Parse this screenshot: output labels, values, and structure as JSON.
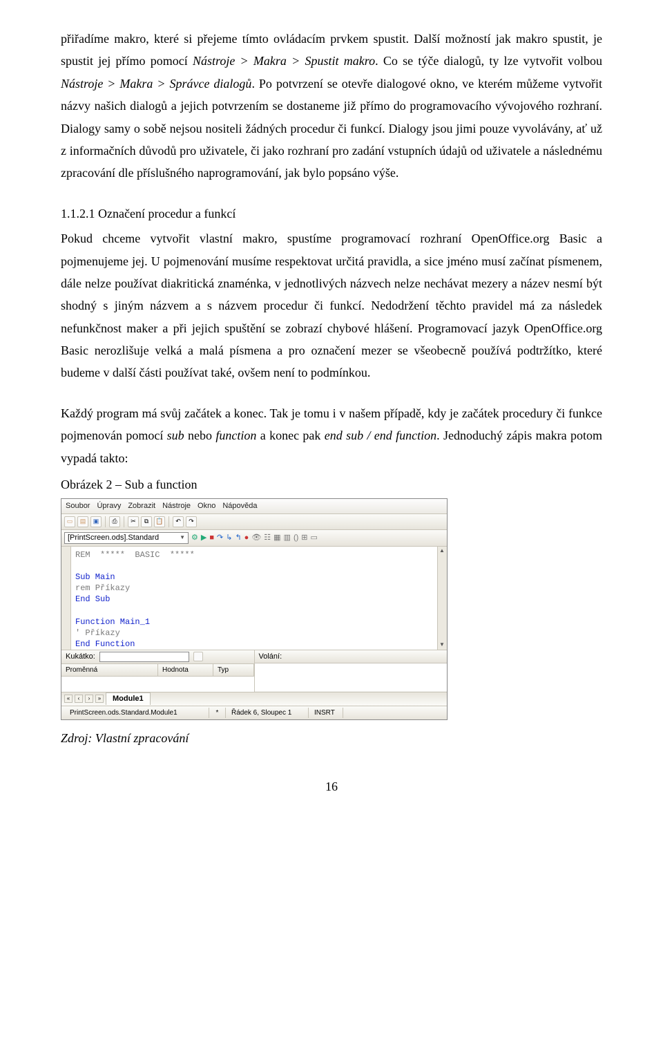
{
  "paragraphs": {
    "p1_a": "přiřadíme makro, které si přejeme tímto ovládacím prvkem spustit. Další možností jak makro spustit, je spustit jej přímo pomocí ",
    "p1_i1": "Nástroje > Makra > Spustit makro",
    "p1_b": ". Co se týče dialogů, ty lze vytvořit volbou ",
    "p1_i2": "Nástroje > Makra > Správce dialogů",
    "p1_c": ". Po potvrzení se otevře dialogové okno, ve kterém můžeme vytvořit názvy našich dialogů a jejich potvrzením se dostaneme již přímo do programovacího vývojového rozhraní. Dialogy samy o sobě nejsou nositeli žádných procedur či funkcí. Dialogy jsou jimi pouze vyvolávány, ať už z informačních důvodů pro uživatele, či jako rozhraní pro zadání vstupních údajů od uživatele a následnému zpracování dle příslušného naprogramování, jak bylo popsáno výše.",
    "heading": "1.1.2.1 Označení procedur a funkcí",
    "p2_a": "Pokud chceme vytvořit vlastní makro, spustíme programovací rozhraní OpenOffice.org Basic a pojmenujeme jej. U pojmenování musíme respektovat určitá pravidla, a sice jméno musí začínat písmenem, dále nelze používat diakritická znaménka, v jednotlivých názvech nelze nechávat mezery a název nesmí být shodný s jiným názvem a s názvem procedur či funkcí. Nedodržení těchto pravidel má za následek nefunkčnost maker a při jejich spuštění se zobrazí chybové hlášení. Programovací jazyk OpenOffice.org Basic nerozlišuje velká a malá písmena a pro označení mezer se všeobecně používá podtržítko, které budeme v další části používat také, ovšem není to podmínkou.",
    "p3_a": "Každý program má svůj začátek a konec. Tak je tomu i v našem případě, kdy je začátek procedury či funkce pojmenován pomocí ",
    "p3_i1": "sub",
    "p3_b": " nebo ",
    "p3_i2": "function",
    "p3_c": " a konec pak ",
    "p3_i3": "end sub / end function",
    "p3_d": ". Jednoduchý zápis makra potom vypadá takto:",
    "fig_caption": "Obrázek 2 – Sub a function"
  },
  "ide": {
    "menu": [
      "Soubor",
      "Úpravy",
      "Zobrazit",
      "Nástroje",
      "Okno",
      "Nápověda"
    ],
    "combo_text": "[PrintScreen.ods].Standard",
    "code": {
      "l1": "REM  *****  BASIC  *****",
      "l2": "",
      "l3": "Sub Main",
      "l4": "rem Příkazy",
      "l5": "End Sub",
      "l6": "",
      "l7": "Function Main_1",
      "l8": "' Příkazy",
      "l9": "End Function"
    },
    "watch": {
      "left_label": "Kukátko:",
      "right_label": "Volání:",
      "col1": "Proměnná",
      "col2": "Hodnota",
      "col3": "Typ"
    },
    "tab": "Module1",
    "status": {
      "s1": "PrintScreen.ods.Standard.Module1",
      "s2": "*",
      "s3": "Řádek 6, Sloupec 1",
      "s4": "INSRT"
    }
  },
  "source": "Zdroj: Vlastní zpracování",
  "page_number": "16"
}
